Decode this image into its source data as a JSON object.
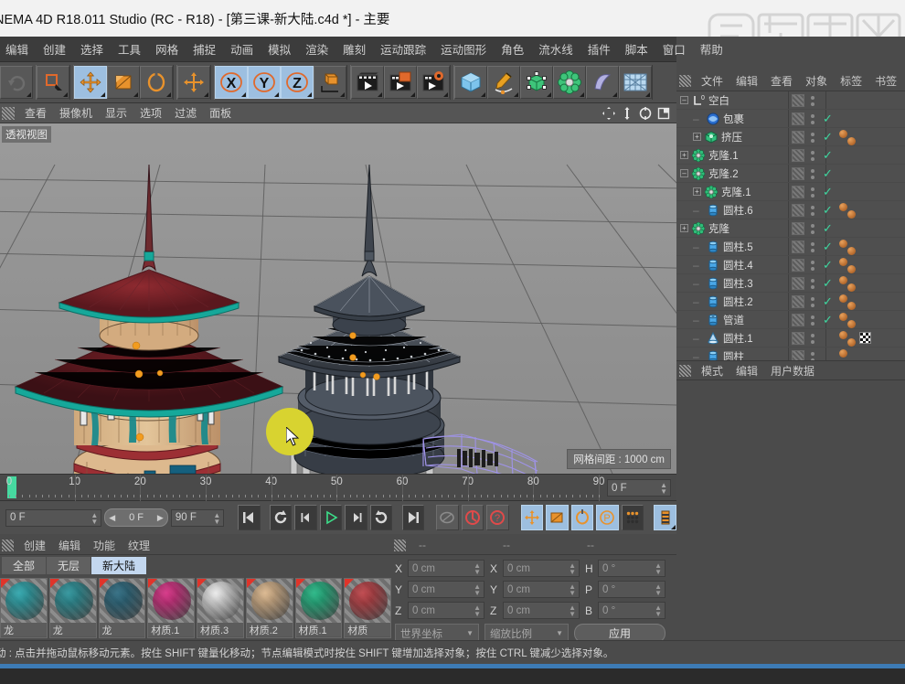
{
  "window": {
    "title": "NEMA 4D R18.011 Studio (RC - R18) - [第三课-新大陆.c4d *] - 主要",
    "watermark": "虎课网"
  },
  "menubar": {
    "items": [
      "编辑",
      "创建",
      "选择",
      "工具",
      "网格",
      "捕捉",
      "动画",
      "模拟",
      "渲染",
      "雕刻",
      "运动跟踪",
      "运动图形",
      "角色",
      "流水线",
      "插件",
      "脚本",
      "窗口",
      "帮助"
    ]
  },
  "toolbar": {
    "groups": [
      {
        "buttons": [
          {
            "icon": "undo-icon",
            "selected": false,
            "disabled": true
          }
        ]
      },
      {
        "buttons": [
          {
            "icon": "selection-tool-icon",
            "selected": false,
            "disabled": false
          }
        ]
      },
      {
        "buttons": [
          {
            "icon": "move-tool-icon",
            "selected": true,
            "disabled": false
          },
          {
            "icon": "scale-tool-icon",
            "selected": false,
            "disabled": false
          },
          {
            "icon": "rotate-tool-icon",
            "selected": false,
            "disabled": false
          }
        ]
      },
      {
        "buttons": [
          {
            "icon": "move-axis-icon",
            "selected": false,
            "disabled": false
          }
        ]
      },
      {
        "buttons": [
          {
            "icon": "axis-x-icon",
            "selected": true,
            "disabled": false
          },
          {
            "icon": "axis-y-icon",
            "selected": true,
            "disabled": false
          },
          {
            "icon": "axis-z-icon",
            "selected": true,
            "disabled": false
          },
          {
            "icon": "world-coord-icon",
            "selected": false,
            "disabled": false
          }
        ]
      },
      {
        "buttons": [
          {
            "icon": "render-view-icon",
            "selected": false,
            "disabled": false
          },
          {
            "icon": "render-region-icon",
            "selected": false,
            "disabled": false
          },
          {
            "icon": "render-settings-icon",
            "selected": false,
            "disabled": false
          }
        ]
      },
      {
        "buttons": [
          {
            "icon": "cube-primitive-icon",
            "selected": false,
            "disabled": false
          },
          {
            "icon": "spline-pen-icon",
            "selected": false,
            "disabled": false
          },
          {
            "icon": "generator-nurbs-icon",
            "selected": false,
            "disabled": false
          },
          {
            "icon": "deformer-icon",
            "selected": false,
            "disabled": false
          },
          {
            "icon": "scene-object-icon",
            "selected": false,
            "disabled": false
          },
          {
            "icon": "scene-light-icon",
            "selected": false,
            "disabled": false
          }
        ]
      }
    ]
  },
  "viewport": {
    "menu": [
      "查看",
      "摄像机",
      "显示",
      "选项",
      "过滤",
      "面板"
    ],
    "label": "透视视图",
    "grid_info": "网格间距 : 1000 cm",
    "axis_labels": {
      "x": "X",
      "y": "Y",
      "z": "Z"
    }
  },
  "timeline": {
    "ticks": [
      0,
      10,
      20,
      30,
      40,
      50,
      60,
      70,
      80,
      90
    ],
    "current_frame_right": "0 F",
    "current_frame": "0 F",
    "preview_frame": "0 F",
    "end_frame": "90 F",
    "playhead_frame": 0,
    "transport": [
      {
        "icon": "go-to-start-icon"
      },
      {
        "icon": "prev-keyframe-icon"
      },
      {
        "icon": "step-back-icon"
      },
      {
        "icon": "play-icon"
      },
      {
        "icon": "step-forward-icon"
      },
      {
        "icon": "next-keyframe-icon"
      },
      {
        "icon": "go-to-end-icon"
      }
    ],
    "record_group": [
      {
        "icon": "autokey-icon",
        "selected": false
      },
      {
        "icon": "record-active-objects-icon",
        "selected": false
      },
      {
        "icon": "keyframe-selection-icon",
        "selected": false
      }
    ],
    "key_group": [
      {
        "icon": "record-position-icon",
        "selected": true
      },
      {
        "icon": "record-scale-icon",
        "selected": true
      },
      {
        "icon": "record-rotation-icon",
        "selected": true
      },
      {
        "icon": "record-param-icon",
        "selected": true
      },
      {
        "icon": "record-pla-icon",
        "selected": false
      }
    ],
    "layout_button": {
      "icon": "timeline-layout-icon",
      "selected": true
    }
  },
  "material_manager": {
    "menu": [
      "创建",
      "编辑",
      "功能",
      "纹理"
    ],
    "tabs": [
      {
        "label": "全部",
        "active": false
      },
      {
        "label": "无层",
        "active": false
      },
      {
        "label": "新大陆",
        "active": true
      }
    ],
    "materials": [
      {
        "name": "龙",
        "color": "#1f9fa6"
      },
      {
        "name": "龙",
        "color": "#1d8b93"
      },
      {
        "name": "龙",
        "color": "#1d5f76"
      },
      {
        "name": "材质.1",
        "color": "#d2217a"
      },
      {
        "name": "材质.3",
        "color": "#e9e9e9"
      },
      {
        "name": "材质.2",
        "color": "#d8b184"
      },
      {
        "name": "材质.1",
        "color": "#14b07a"
      },
      {
        "name": "材质",
        "color": "#b8343a"
      }
    ]
  },
  "coordinates": {
    "header_dashes": [
      "--",
      "--",
      "--"
    ],
    "position": {
      "label_x": "X",
      "label_y": "Y",
      "label_z": "Z",
      "x": "0 cm",
      "y": "0 cm",
      "z": "0 cm"
    },
    "size": {
      "label_x": "X",
      "label_y": "Y",
      "label_z": "Z",
      "x": "0 cm",
      "y": "0 cm",
      "z": "0 cm"
    },
    "rotation": {
      "label_h": "H",
      "label_p": "P",
      "label_b": "B",
      "h": "0 °",
      "p": "0 °",
      "b": "0 °"
    },
    "coord_system": "世界坐标",
    "scale_mode": "缩放比例",
    "apply_label": "应用"
  },
  "object_manager": {
    "menu": [
      "文件",
      "编辑",
      "查看",
      "对象",
      "标签",
      "书签"
    ],
    "rows": [
      {
        "name": "空白",
        "indent": 0,
        "expander": "minus",
        "icon": "null-object-icon",
        "check": false,
        "materials": 0,
        "checker": false
      },
      {
        "name": "包裹",
        "indent": 1,
        "expander": "none",
        "icon": "wrap-deformer-icon",
        "check": true,
        "materials": 0,
        "checker": false
      },
      {
        "name": "挤压",
        "indent": 1,
        "expander": "plus",
        "icon": "extrude-generator-icon",
        "check": true,
        "materials": 2,
        "checker": false
      },
      {
        "name": "克隆.1",
        "indent": 0,
        "expander": "plus",
        "icon": "cloner-icon",
        "check": true,
        "materials": 0,
        "checker": false
      },
      {
        "name": "克隆.2",
        "indent": 0,
        "expander": "minus",
        "icon": "cloner-icon",
        "check": true,
        "materials": 0,
        "checker": false
      },
      {
        "name": "克隆.1",
        "indent": 1,
        "expander": "plus",
        "icon": "cloner-icon",
        "check": true,
        "materials": 0,
        "checker": false
      },
      {
        "name": "圆柱.6",
        "indent": 1,
        "expander": "none",
        "icon": "cylinder-icon",
        "check": true,
        "materials": 2,
        "checker": false
      },
      {
        "name": "克隆",
        "indent": 0,
        "expander": "plus",
        "icon": "cloner-icon",
        "check": true,
        "materials": 0,
        "checker": false
      },
      {
        "name": "圆柱.5",
        "indent": 1,
        "expander": "none",
        "icon": "cylinder-icon",
        "check": true,
        "materials": 2,
        "checker": false
      },
      {
        "name": "圆柱.4",
        "indent": 1,
        "expander": "none",
        "icon": "cylinder-icon",
        "check": true,
        "materials": 2,
        "checker": false
      },
      {
        "name": "圆柱.3",
        "indent": 1,
        "expander": "none",
        "icon": "cylinder-icon",
        "check": true,
        "materials": 2,
        "checker": false
      },
      {
        "name": "圆柱.2",
        "indent": 1,
        "expander": "none",
        "icon": "cylinder-icon",
        "check": true,
        "materials": 2,
        "checker": false
      },
      {
        "name": "管道",
        "indent": 1,
        "expander": "none",
        "icon": "tube-icon",
        "check": true,
        "materials": 2,
        "checker": false
      },
      {
        "name": "圆柱.1",
        "indent": 1,
        "expander": "none",
        "icon": "cone-icon",
        "check": false,
        "materials": 2,
        "checker": true
      },
      {
        "name": "圆柱",
        "indent": 1,
        "expander": "none",
        "icon": "cylinder-icon",
        "check": false,
        "materials": 1,
        "checker": false
      }
    ]
  },
  "attribute_manager": {
    "menu": [
      "模式",
      "编辑",
      "用户数据"
    ]
  },
  "statusbar": {
    "text": "动 : 点击并拖动鼠标移动元素。按住 SHIFT 键量化移动；节点编辑模式时按住 SHIFT 键增加选择对象；按住 CTRL 键减少选择对象。"
  },
  "colors": {
    "accent_selected": "#9dbfe0",
    "orange": "#e8922c",
    "green_check": "#3fd7a0",
    "playhead": "#46d9a0",
    "cursor_blob": "#d8d330",
    "bottom_bar": "#3d7bb5"
  }
}
